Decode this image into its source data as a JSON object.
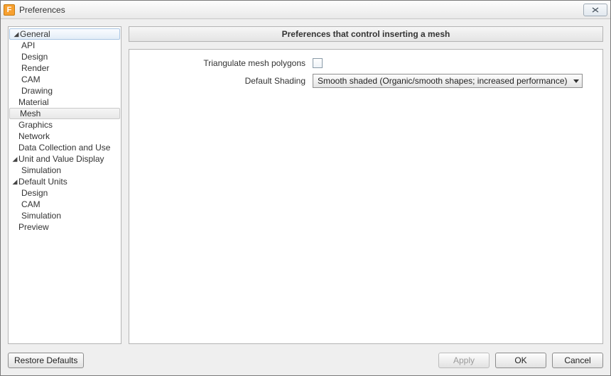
{
  "window": {
    "title": "Preferences",
    "icon_letter": "F"
  },
  "tree": {
    "items": [
      {
        "label": "General",
        "level": 0,
        "expanded": true,
        "selected": true
      },
      {
        "label": "API",
        "level": 1
      },
      {
        "label": "Design",
        "level": 1
      },
      {
        "label": "Render",
        "level": 1
      },
      {
        "label": "CAM",
        "level": 1
      },
      {
        "label": "Drawing",
        "level": 1
      },
      {
        "label": "Material",
        "level": 0
      },
      {
        "label": "Mesh",
        "level": 0,
        "highlighted": true
      },
      {
        "label": "Graphics",
        "level": 0
      },
      {
        "label": "Network",
        "level": 0
      },
      {
        "label": "Data Collection and Use",
        "level": 0
      },
      {
        "label": "Unit and Value Display",
        "level": 0,
        "expanded": true
      },
      {
        "label": "Simulation",
        "level": 1
      },
      {
        "label": "Default Units",
        "level": 0,
        "expanded": true
      },
      {
        "label": "Design",
        "level": 1
      },
      {
        "label": "CAM",
        "level": 1
      },
      {
        "label": "Simulation",
        "level": 1
      },
      {
        "label": "Preview",
        "level": 0
      }
    ]
  },
  "panel": {
    "header": "Preferences that control inserting a mesh",
    "triangulate_label": "Triangulate mesh polygons",
    "triangulate_checked": false,
    "shading_label": "Default Shading",
    "shading_value": "Smooth shaded (Organic/smooth shapes; increased performance)"
  },
  "buttons": {
    "restore": "Restore Defaults",
    "apply": "Apply",
    "ok": "OK",
    "cancel": "Cancel"
  }
}
